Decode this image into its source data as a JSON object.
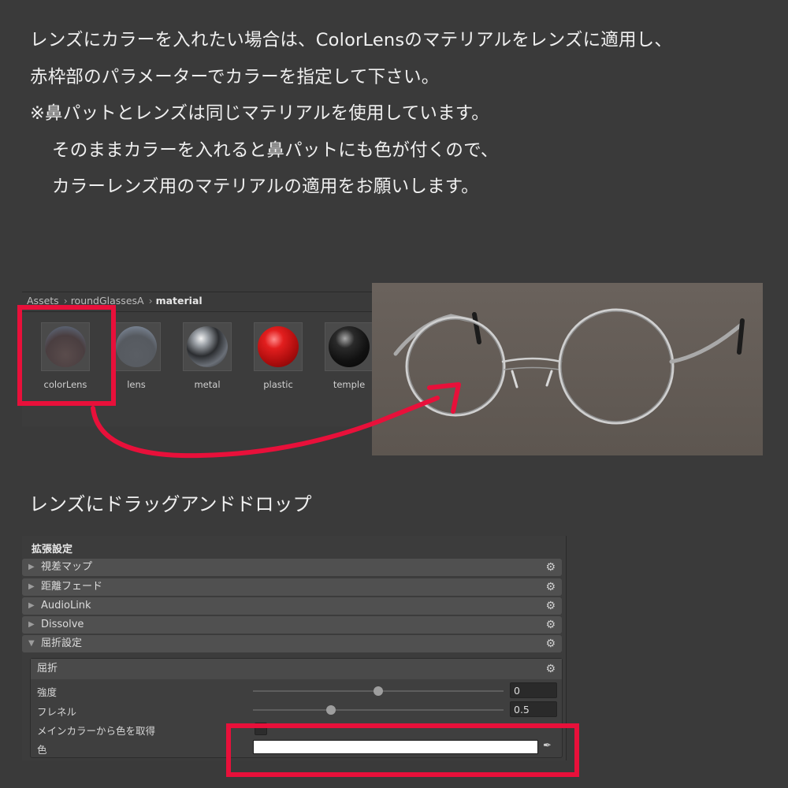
{
  "instructions": {
    "line1": "レンズにカラーを入れたい場合は、ColorLensのマテリアルをレンズに適用し、",
    "line2": "赤枠部のパラメーターでカラーを指定して下さい。",
    "line3": "※鼻パットとレンズは同じマテリアルを使用しています。",
    "line4": "そのままカラーを入れると鼻パットにも色が付くので、",
    "line5": "カラーレンズ用のマテリアルの適用をお願いします。"
  },
  "project": {
    "breadcrumb": [
      "Assets",
      "roundGlassesA",
      "material"
    ],
    "assets": [
      {
        "label": "colorLens"
      },
      {
        "label": "lens"
      },
      {
        "label": "metal"
      },
      {
        "label": "plastic"
      },
      {
        "label": "temple"
      }
    ]
  },
  "drag_label": "レンズにドラッグアンドドロップ",
  "inspector": {
    "title": "拡張設定",
    "folds": [
      {
        "label": "視差マップ",
        "expanded": false
      },
      {
        "label": "距離フェード",
        "expanded": false
      },
      {
        "label": "AudioLink",
        "expanded": false
      },
      {
        "label": "Dissolve",
        "expanded": false
      },
      {
        "label": "屈折設定",
        "expanded": true
      }
    ],
    "refraction": {
      "header": "屈折",
      "strength": {
        "label": "強度",
        "value": "0",
        "slider_fraction": 0.5
      },
      "fresnel": {
        "label": "フレネル",
        "value": "0.5",
        "slider_fraction": 0.31
      },
      "main_color": {
        "label": "メインカラーから色を取得",
        "checked": false
      },
      "color": {
        "label": "色",
        "value": "#ffffff"
      }
    }
  },
  "colors": {
    "highlight": "#e8103a",
    "background": "#3a3a3a"
  },
  "icons": {
    "gear": "gear-icon",
    "fold_closed": "triangle-right-icon",
    "fold_open": "triangle-down-icon",
    "picker": "eyedropper-icon"
  }
}
